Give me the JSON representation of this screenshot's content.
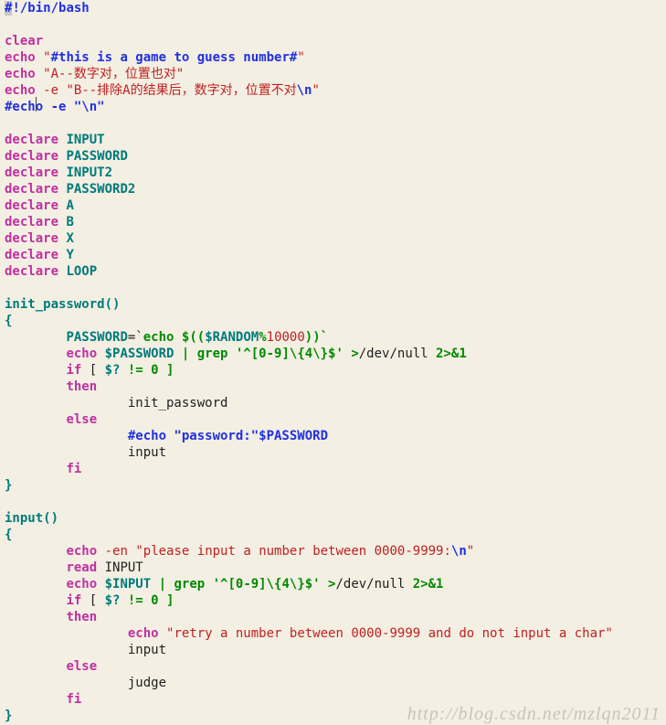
{
  "code": {
    "shebang_hash": "#",
    "shebang_rest": "!/bin/bash",
    "clear": "clear",
    "echo": "echo",
    "echo_e": "-e",
    "echo_en": "-en",
    "q": "\"",
    "str1": "#this is a game to guess number#",
    "str2": "A--数字对，位置也对",
    "str3": "B--排除A的结果后，数字对，位置不对",
    "nl": "\\n",
    "comment_echo_nl": "#echo -e \"\\n\"",
    "declare": "declare",
    "var_INPUT": "INPUT",
    "var_PASSWORD": "PASSWORD",
    "var_INPUT2": "INPUT2",
    "var_PASSWORD2": "PASSWORD2",
    "var_A": "A",
    "var_B": "B",
    "var_X": "X",
    "var_Y": "Y",
    "var_LOOP": "LOOP",
    "fn_init": "init_password()",
    "fn_input": "input()",
    "lbrace": "{",
    "rbrace": "}",
    "PASSWORD": "PASSWORD",
    "eq_bt": "=`",
    "dpo": "$((",
    "RANDOM": "$RANDOM",
    "mod": "%",
    "tenk": "10000",
    "dpc_bt": "))`",
    "dollar_password": "$PASSWORD",
    "grep_pat": " | grep '^[0-9]\\{4\\}$' >",
    "devnull": "/dev/null ",
    "redir": "2>&1",
    "if": "if",
    "test": " [ ",
    "qm": "$?",
    "neq": " != 0 ]",
    "then": "then",
    "else": "else",
    "fi": "fi",
    "call_init": "init_password",
    "comment_echo_pwd": "#echo \"password:\"$PASSWORD",
    "call_input": "input",
    "call_judge": "judge",
    "str_please": "please input a number between 0000-9999:",
    "read": "read",
    "read_arg": " INPUT",
    "dollar_input": "$INPUT",
    "str_retry": "retry a number between 0000-9999 and do not input a char"
  },
  "watermark": "http://blog.csdn.net/mzlqn2011"
}
